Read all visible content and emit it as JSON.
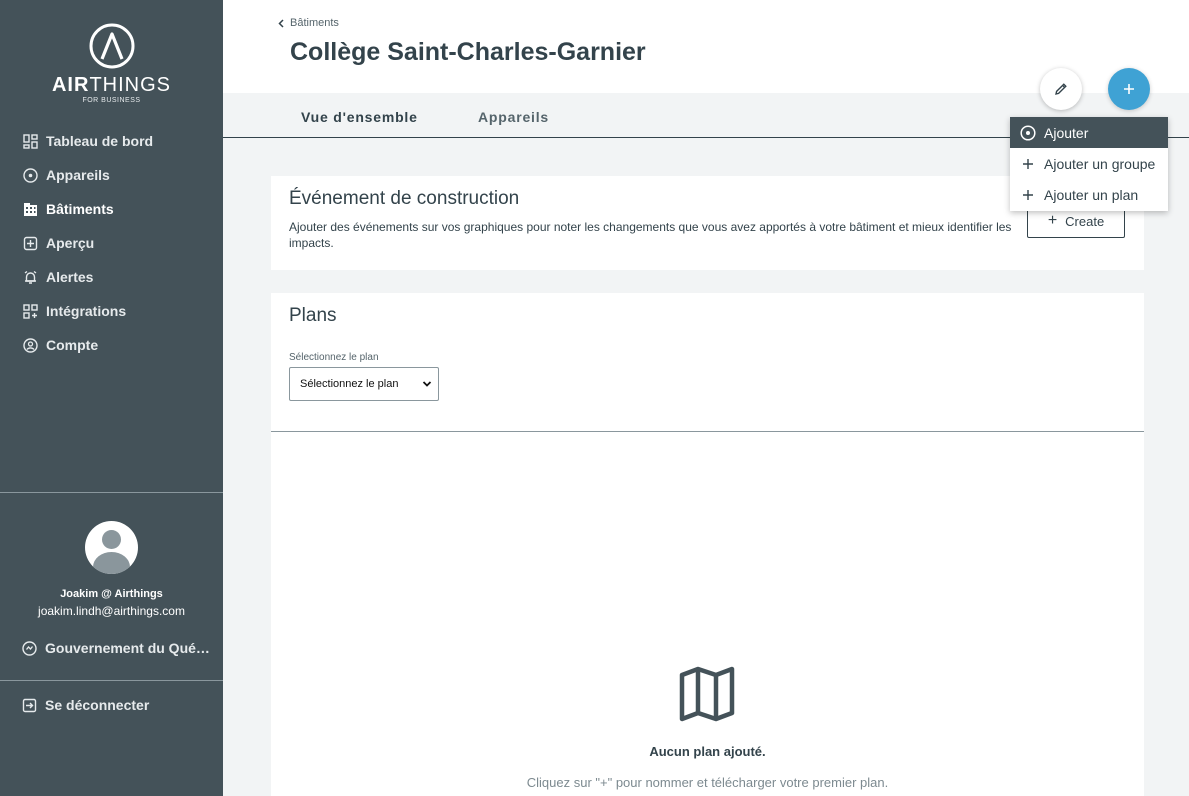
{
  "brand": {
    "name_bold": "AIR",
    "name_rest": "THINGS",
    "subtitle": "FOR BUSINESS"
  },
  "sidebar": {
    "items": [
      {
        "label": "Tableau de bord",
        "icon": "dashboard-icon",
        "active": false
      },
      {
        "label": "Appareils",
        "icon": "device-icon",
        "active": false
      },
      {
        "label": "Bâtiments",
        "icon": "building-icon",
        "active": true
      },
      {
        "label": "Aperçu",
        "icon": "insight-icon",
        "active": false
      },
      {
        "label": "Alertes",
        "icon": "bell-icon",
        "active": false
      },
      {
        "label": "Intégrations",
        "icon": "integrations-icon",
        "active": false
      },
      {
        "label": "Compte",
        "icon": "account-icon",
        "active": false
      }
    ],
    "user": {
      "name": "Joakim @ Airthings",
      "email": "joakim.lindh@airthings.com"
    },
    "organization": "Gouvernement du Québec",
    "logout": "Se déconnecter"
  },
  "header": {
    "breadcrumb": "Bâtiments",
    "title": "Collège Saint-Charles-Garnier"
  },
  "tabs": [
    {
      "label": "Vue d'ensemble",
      "active": true
    },
    {
      "label": "Appareils",
      "active": false
    }
  ],
  "add_menu": {
    "items": [
      {
        "label": "Ajouter",
        "icon": "device-icon",
        "highlighted": true
      },
      {
        "label": "Ajouter un groupe",
        "icon": "plus-icon",
        "highlighted": false
      },
      {
        "label": "Ajouter un plan",
        "icon": "plus-icon",
        "highlighted": false
      }
    ]
  },
  "event_card": {
    "title": "Événement de construction",
    "description": "Ajouter des événements sur vos graphiques pour noter les changements que vous avez apportés à votre bâtiment et mieux identifier les impacts.",
    "create_label": "Create"
  },
  "plans_card": {
    "title": "Plans",
    "select_label": "Sélectionnez le plan",
    "select_value": "Sélectionnez le plan",
    "empty_title": "Aucun plan ajouté.",
    "empty_hint": "Cliquez sur \"+\" pour nommer et télécharger votre premier plan."
  },
  "colors": {
    "sidebar": "#445259",
    "accent": "#3fa2d4",
    "text": "#33434b",
    "background": "#f2f4f5"
  }
}
